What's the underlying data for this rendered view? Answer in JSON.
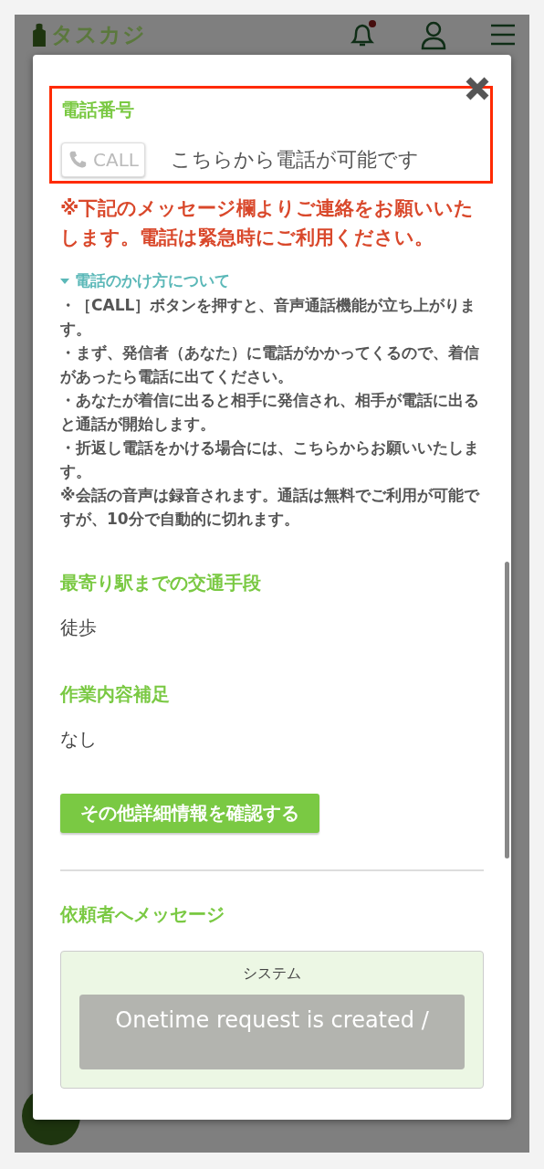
{
  "header": {
    "logo": "タスカジ",
    "notification_dot": true
  },
  "modal": {
    "phone": {
      "title": "電話番号",
      "call_button": {
        "label": "CALL",
        "disabled": true
      },
      "note": "こちらから電話が可能です",
      "highlighted": true
    },
    "warning": "※下記のメッセージ欄よりご連絡をお願いいたします。電話は緊急時にご利用ください。",
    "howto": {
      "label": "電話のかけ方について",
      "expanded": true,
      "lines": [
        "・［CALL］ボタンを押すと、音声通話機能が立ち上がります。",
        "・まず、発信者（あなた）に電話がかかってくるので、着信があったら電話に出てください。",
        "・あなたが着信に出ると相手に発信され、相手が電話に出ると通話が開始します。",
        "・折返し電話をかける場合には、こちらからお願いいたします。",
        "※会話の音声は録音されます。通話は無料でご利用が可能ですが、10分で自動的に切れます。"
      ]
    },
    "sections": [
      {
        "title": "最寄り駅までの交通手段",
        "value": "徒歩"
      },
      {
        "title": "作業内容補足",
        "value": "なし"
      }
    ],
    "details_button": "その他詳細情報を確認する",
    "message": {
      "title": "依頼者へメッセージ",
      "sender": "システム",
      "text": "Onetime request is created /"
    }
  }
}
